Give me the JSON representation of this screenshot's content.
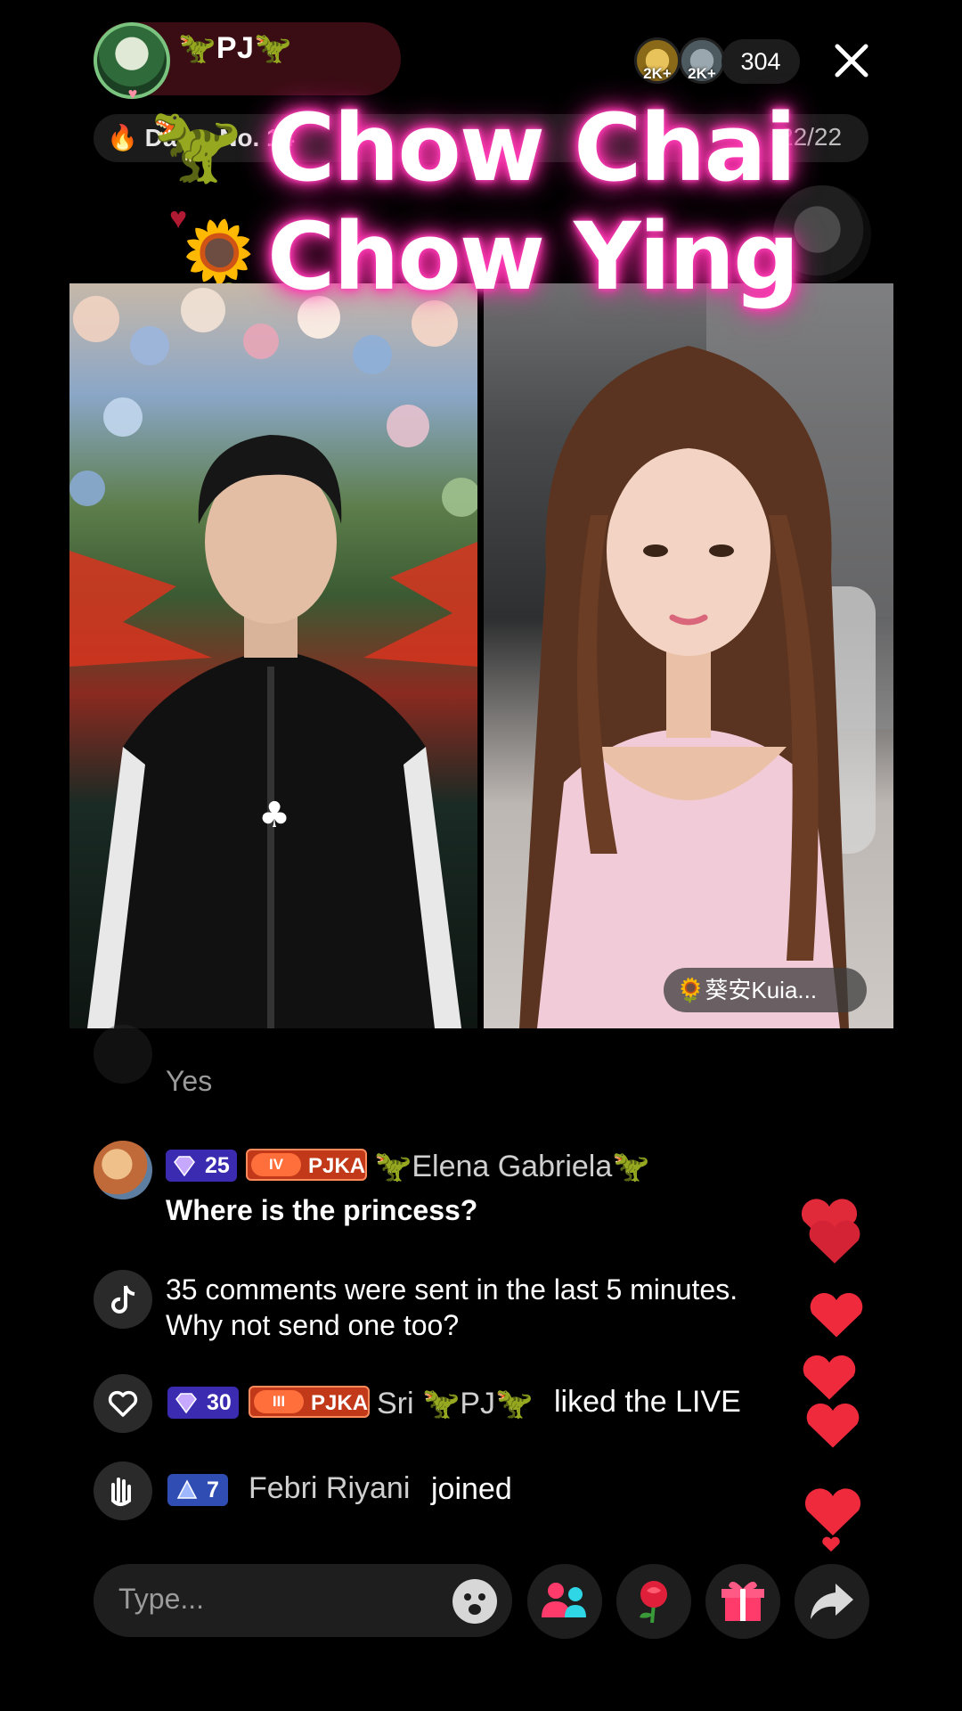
{
  "header": {
    "host_name": "🦖PJ🦖",
    "viewer_avatars": [
      {
        "badge": "2K+"
      },
      {
        "badge": "2K+"
      }
    ],
    "viewer_count": "304",
    "close_icon": "close-icon"
  },
  "daily": {
    "left_text": "Da",
    "left_text_2": "No. 14",
    "right_text": "22/22"
  },
  "overlay_title": {
    "line1": "Chow Chai",
    "line2": "Chow Ying"
  },
  "guest": {
    "name": "🌻葵安Kuia..."
  },
  "chat": {
    "faded_message": "Yes",
    "items": [
      {
        "type": "comment",
        "diamond_level": "25",
        "fan_level": "IV",
        "fan_club": "PJKA",
        "username": "🦖Elena Gabriela🦖",
        "message": "Where is the princess?"
      },
      {
        "type": "system",
        "message_line1": "35 comments were sent in the last 5 minutes.",
        "message_line2": "Why not send one too?"
      },
      {
        "type": "like",
        "diamond_level": "30",
        "fan_level": "III",
        "fan_club": "PJKA",
        "username": "Sri 🦖PJ🦖",
        "action": "liked the LIVE"
      },
      {
        "type": "join",
        "level": "7",
        "username": "Febri Riyani",
        "action": "joined"
      }
    ]
  },
  "bottom_bar": {
    "input_placeholder": "Type...",
    "buttons": [
      "emoji-icon",
      "multi-guest-icon",
      "rose-gift-icon",
      "gift-icon",
      "share-icon"
    ]
  },
  "colors": {
    "title_glow": "#ff2ca8",
    "heart": "#ee2a3c",
    "diamond_badge": "#3b2bb0",
    "fan_badge": "#c2391a"
  }
}
